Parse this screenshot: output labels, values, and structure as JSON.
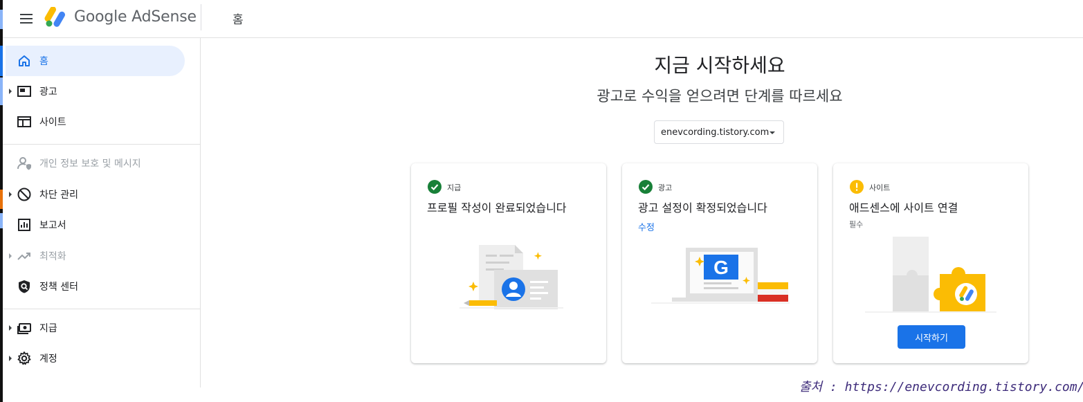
{
  "header": {
    "brand": "Google AdSense",
    "page_title": "홈"
  },
  "sidebar": {
    "items": [
      {
        "label": "홈",
        "icon": "home-icon"
      },
      {
        "label": "광고",
        "icon": "ads-icon"
      },
      {
        "label": "사이트",
        "icon": "sites-icon"
      },
      {
        "label": "개인 정보 보호 및 메시지",
        "icon": "privacy-icon"
      },
      {
        "label": "차단 관리",
        "icon": "block-icon"
      },
      {
        "label": "보고서",
        "icon": "reports-icon"
      },
      {
        "label": "최적화",
        "icon": "trending-up-icon"
      },
      {
        "label": "정책 센터",
        "icon": "policy-shield-icon"
      },
      {
        "label": "지급",
        "icon": "payments-icon"
      },
      {
        "label": "계정",
        "icon": "gear-icon"
      }
    ]
  },
  "main": {
    "title": "지금 시작하세요",
    "subtitle": "광고로 수익을 얻으려면 단계를 따르세요",
    "site_selector": "enevcording.tistory.com",
    "cards": [
      {
        "kicker": "지급",
        "title": "프로필 작성이 완료되었습니다",
        "status": "complete"
      },
      {
        "kicker": "광고",
        "title": "광고 설정이 확정되었습니다",
        "link": "수정",
        "status": "complete"
      },
      {
        "kicker": "사이트",
        "title": "애드센스에 사이트 연결",
        "note": "필수",
        "button": "시작하기",
        "status": "warning"
      }
    ]
  },
  "source_caption": "출처 : https://enevcording.tistory.com/",
  "colors": {
    "accent": "#1a73e8",
    "success": "#188038",
    "warning": "#fbbc04",
    "active_bg": "#e8f0fe"
  }
}
